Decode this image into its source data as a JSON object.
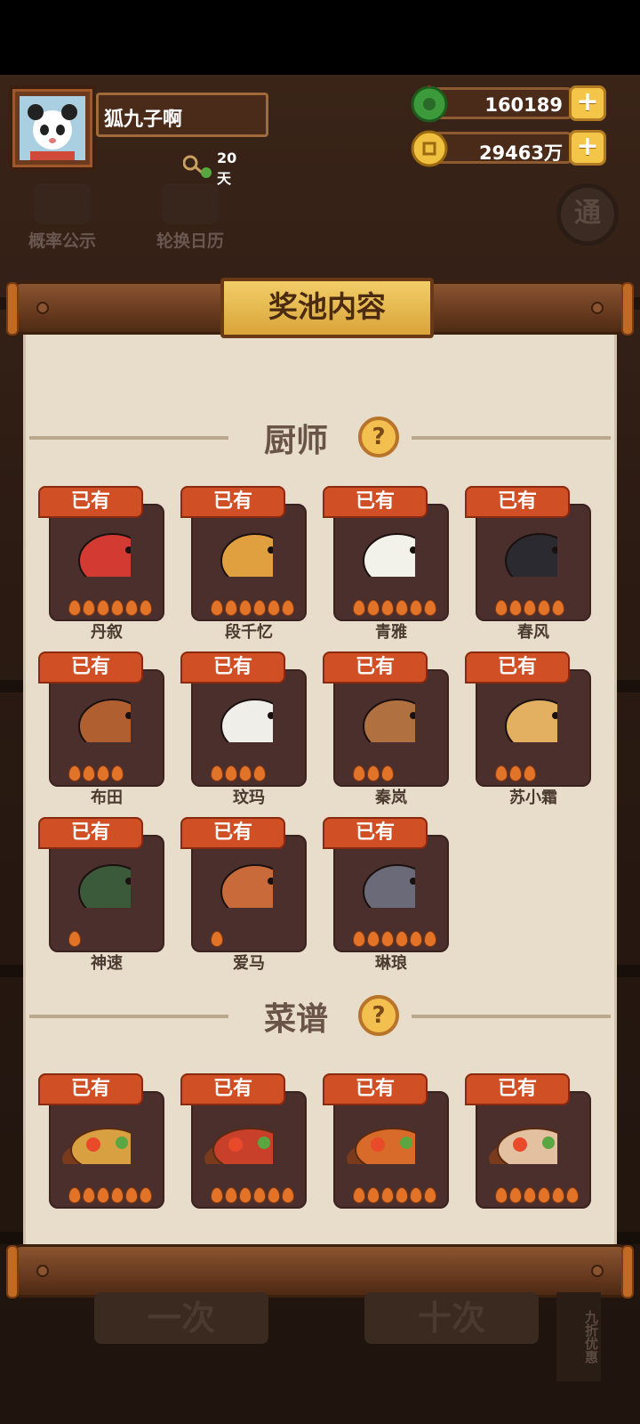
{
  "player": {
    "name": "狐九子啊",
    "days": "20天"
  },
  "currency": {
    "jade": "160189",
    "coins": "29463万",
    "plus": "+"
  },
  "side": {
    "probability": "概率公示",
    "calendar": "轮换日历",
    "round_btn": "通"
  },
  "modal": {
    "title": "奖池内容",
    "sections": {
      "chefs": {
        "title": "厨师",
        "help": "?"
      },
      "recipes": {
        "title": "菜谱",
        "help": "?"
      }
    },
    "owned_label": "已有",
    "chefs": [
      {
        "name": "丹叙",
        "flames": 6,
        "color": "#d23a32"
      },
      {
        "name": "段千忆",
        "flames": 6,
        "color": "#e0a040"
      },
      {
        "name": "青雅",
        "flames": 6,
        "color": "#f2f2ea"
      },
      {
        "name": "春风",
        "flames": 5,
        "color": "#2a2a30"
      },
      {
        "name": "布田",
        "flames": 4,
        "color": "#b06030"
      },
      {
        "name": "玟玛",
        "flames": 4,
        "color": "#f0eee8"
      },
      {
        "name": "秦岚",
        "flames": 3,
        "color": "#b07040"
      },
      {
        "name": "苏小霜",
        "flames": 3,
        "color": "#e2b060"
      },
      {
        "name": "神速",
        "flames": 1,
        "color": "#3a5a3a"
      },
      {
        "name": "爱马",
        "flames": 1,
        "color": "#c86a3a"
      },
      {
        "name": "琳琅",
        "flames": 6,
        "color": "#6a6a78"
      }
    ],
    "recipes": [
      {
        "name": "",
        "flames": 6,
        "color": "#d8a040"
      },
      {
        "name": "",
        "flames": 6,
        "color": "#c8402a"
      },
      {
        "name": "",
        "flames": 6,
        "color": "#d86a2a"
      },
      {
        "name": "",
        "flames": 6,
        "color": "#e2c0a0"
      }
    ]
  },
  "bottom": {
    "one": "一次",
    "ten": "十次",
    "discount": "九折优惠"
  }
}
